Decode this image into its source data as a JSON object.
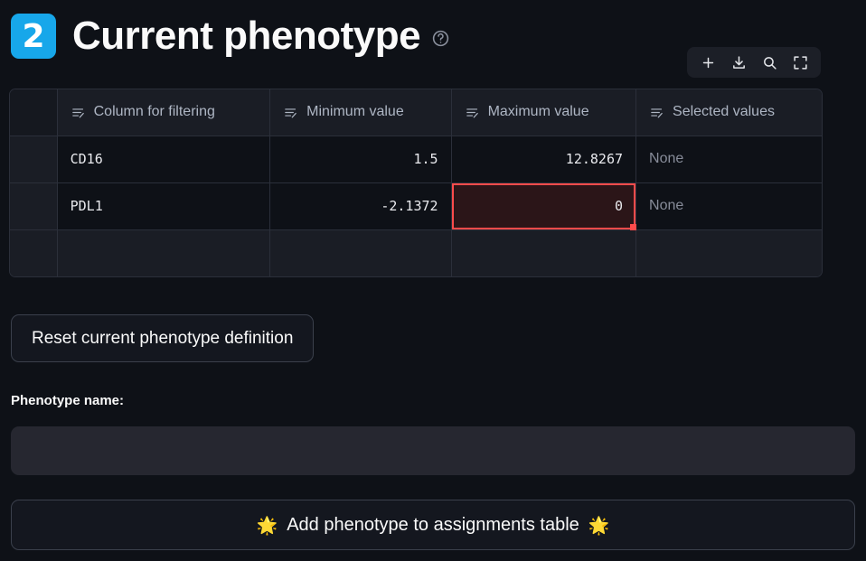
{
  "header": {
    "badge_number": "2",
    "title": "Current phenotype",
    "help_icon": "question-circle-icon"
  },
  "toolbar": {
    "icons": [
      {
        "name": "add-row-icon",
        "label": "+"
      },
      {
        "name": "download-icon",
        "label": "download"
      },
      {
        "name": "search-icon",
        "label": "search"
      },
      {
        "name": "fullscreen-icon",
        "label": "fullscreen"
      }
    ]
  },
  "table": {
    "columns": [
      {
        "key": "index",
        "label": ""
      },
      {
        "key": "column_for_filtering",
        "label": "Column for filtering",
        "icon": "edit-text-column-icon"
      },
      {
        "key": "minimum_value",
        "label": "Minimum value",
        "icon": "edit-text-column-icon"
      },
      {
        "key": "maximum_value",
        "label": "Maximum value",
        "icon": "edit-text-column-icon"
      },
      {
        "key": "selected_values",
        "label": "Selected values",
        "icon": "edit-text-column-icon"
      }
    ],
    "rows": [
      {
        "index": "",
        "column_for_filtering": "CD16",
        "minimum_value": "1.5",
        "maximum_value": "12.8267",
        "selected_values": "None",
        "active_cell": null
      },
      {
        "index": "",
        "column_for_filtering": "PDL1",
        "minimum_value": "-2.1372",
        "maximum_value": "0",
        "selected_values": "None",
        "active_cell": "maximum_value"
      },
      {
        "index": "",
        "column_for_filtering": "",
        "minimum_value": "",
        "maximum_value": "",
        "selected_values": "",
        "active_cell": null
      }
    ],
    "active_cell_border_color": "#ff4b4b",
    "active_cell_fill_color": "#2b1518"
  },
  "reset_button": {
    "label": "Reset current phenotype definition"
  },
  "phenotype_name": {
    "label": "Phenotype name:",
    "value": "",
    "placeholder": ""
  },
  "add_button": {
    "left_emoji": "🌟",
    "label": "Add phenotype to assignments table",
    "right_emoji": "🌟"
  },
  "colors": {
    "background": "#0e1117",
    "badge": "#17a7ea",
    "accent_red": "#ff4b4b",
    "input_bg": "#262730"
  }
}
